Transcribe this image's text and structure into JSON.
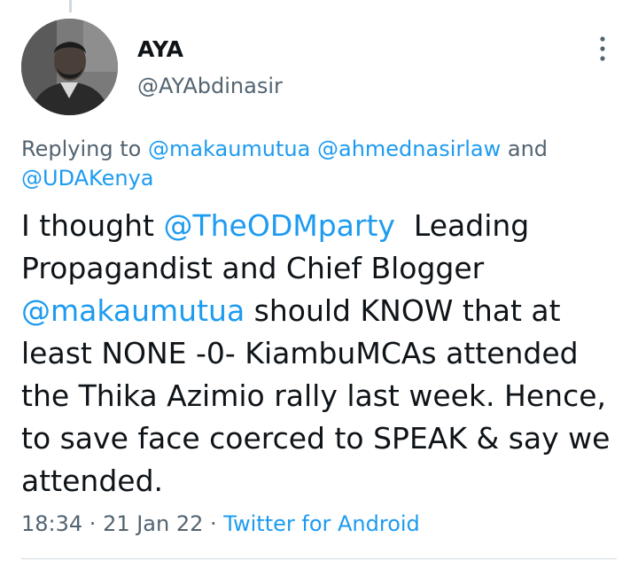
{
  "author": {
    "display_name": "AYA",
    "handle": "@AYAbdinasir",
    "avatar_icon": "profile-photo"
  },
  "menu": {
    "icon": "more-vertical-icon"
  },
  "reply": {
    "prefix": "Replying to ",
    "mention_1": "@makaumutua",
    "mention_2": "@ahmednasirlaw",
    "conjunction": " and ",
    "mention_3": "@UDAKenya"
  },
  "tweet": {
    "part1": "I thought ",
    "mention_odm": "@TheODMparty",
    "part2": "  Leading Propagandist and Chief Blogger ",
    "mention_makau": "@makaumutua",
    "part3": " should KNOW that at least NONE -0- KiambuMCAs attended the Thika Azimio rally last week. Hence, to save face coerced to SPEAK & say we attended."
  },
  "meta": {
    "time": "18:34",
    "separator": " · ",
    "date": "21 Jan 22",
    "source": "Twitter for Android"
  },
  "colors": {
    "link": "#1d9bf0",
    "secondary_text": "#536471",
    "primary_text": "#0f1419"
  }
}
